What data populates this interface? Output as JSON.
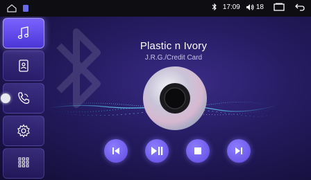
{
  "status_bar": {
    "time": "17:09",
    "volume": "18",
    "icons": [
      "home-outline-icon",
      "app-square-icon",
      "bluetooth-icon",
      "volume-icon",
      "recent-apps-icon",
      "back-icon"
    ]
  },
  "sidebar": {
    "items": [
      {
        "name": "music",
        "icon": "music-note-icon",
        "active": true
      },
      {
        "name": "contacts",
        "icon": "contacts-book-icon",
        "active": false
      },
      {
        "name": "phone",
        "icon": "phone-icon",
        "active": false
      },
      {
        "name": "settings",
        "icon": "gear-icon",
        "active": false
      },
      {
        "name": "dialpad",
        "icon": "dialpad-grid-icon",
        "active": false
      }
    ]
  },
  "now_playing": {
    "title": "Plastic n Ivory",
    "artist": "J.R.G./Credit Card"
  },
  "controls": [
    {
      "name": "previous",
      "icon": "skip-previous-icon"
    },
    {
      "name": "play-pause",
      "icon": "play-pause-icon"
    },
    {
      "name": "stop",
      "icon": "stop-icon"
    },
    {
      "name": "next",
      "icon": "skip-next-icon"
    }
  ],
  "colors": {
    "accent": "#6e58f0",
    "background": "#261c63",
    "statusbar": "#0d0d12"
  }
}
